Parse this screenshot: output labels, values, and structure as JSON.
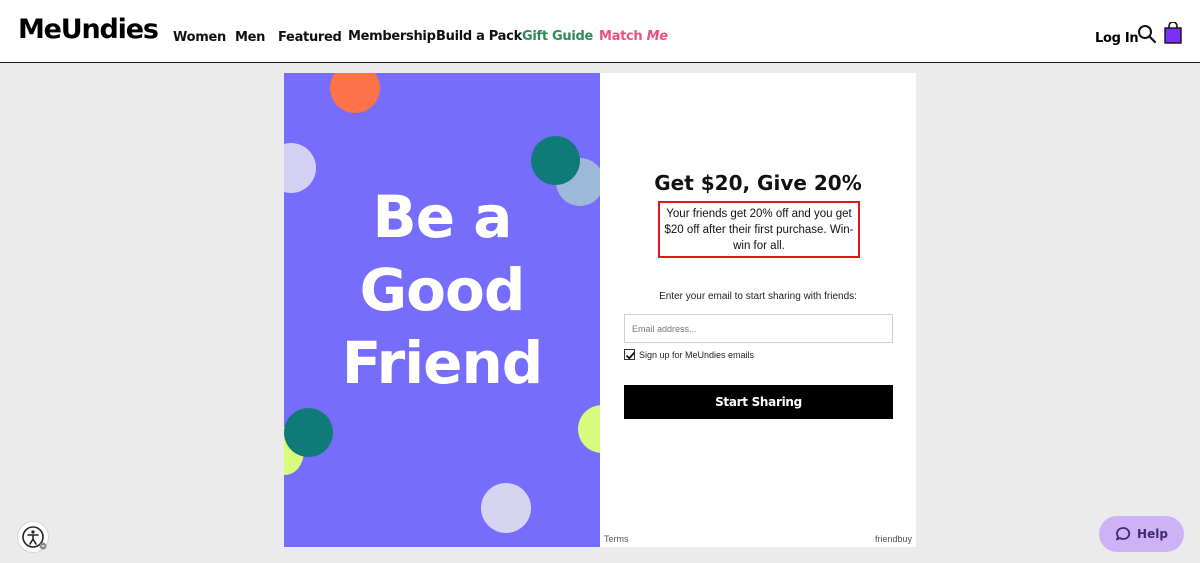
{
  "header": {
    "logo": "MeUndies",
    "nav": [
      {
        "label": "Women"
      },
      {
        "label": "Men"
      },
      {
        "label": "Featured"
      },
      {
        "label": "Membership"
      },
      {
        "label": "Build a Pack"
      },
      {
        "label": "Gift Guide",
        "color": "#2e8a57"
      },
      {
        "label_main": "Match ",
        "label_accent": "Me",
        "color": "#ec4f86"
      }
    ],
    "login": "Log In",
    "icons": {
      "search": "search-icon",
      "bag": "shopping-bag-icon",
      "bag_color": "#7b2ff7"
    }
  },
  "modal": {
    "art": {
      "headline": [
        "Be a",
        "Good",
        "Friend"
      ],
      "background": "#776dfd"
    },
    "offer": {
      "title": "Get $20, Give 20%",
      "description": "Your friends get 20% off and you get $20 off after their first purchase. Win-win for all.",
      "highlight_color": "#e4161b"
    },
    "form": {
      "prompt": "Enter your email to start sharing with friends:",
      "email_placeholder": "Email address...",
      "email_value": "",
      "signup_label": "Sign up for MeUndies emails",
      "signup_checked": true,
      "submit_label": "Start Sharing"
    },
    "footer": {
      "terms": "Terms",
      "provider": "friendbuy"
    }
  },
  "widgets": {
    "accessibility": "accessibility-icon",
    "help_label": "Help",
    "help_icon": "chat-bubble-icon"
  }
}
